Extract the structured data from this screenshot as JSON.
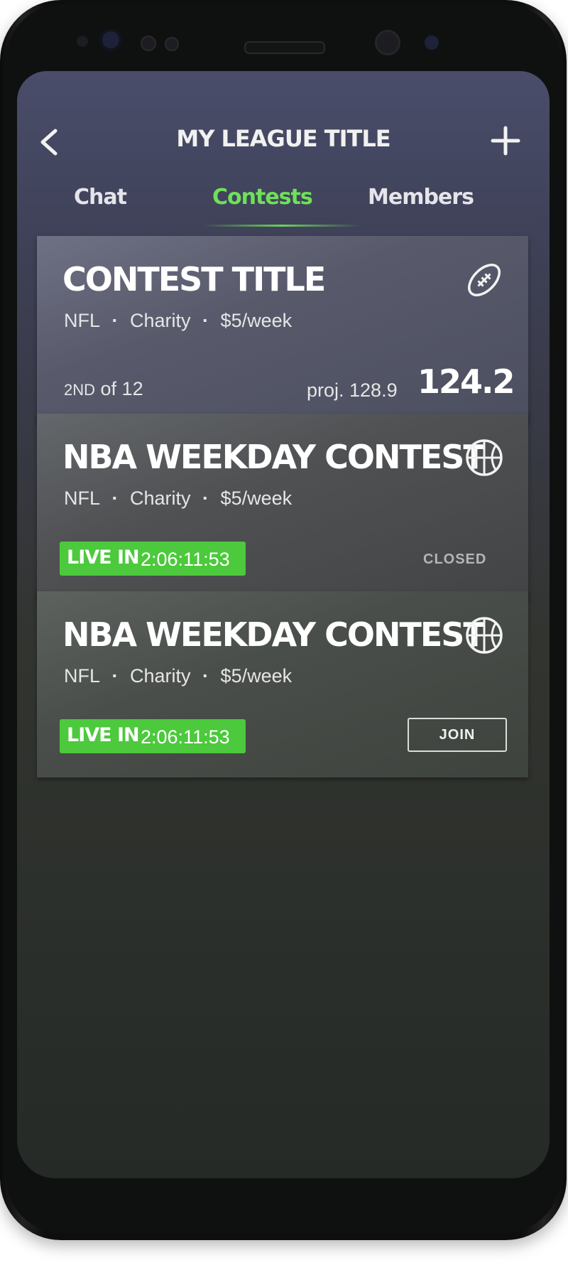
{
  "header": {
    "title": "MY LEAGUE TITLE",
    "back_icon": "chevron-left-icon",
    "add_icon": "plus-icon"
  },
  "tabs": [
    {
      "label": "Chat",
      "active": false
    },
    {
      "label": "Contests",
      "active": true
    },
    {
      "label": "Members",
      "active": false
    }
  ],
  "colors": {
    "accent": "#6fe05a",
    "live_badge": "#4cc93c"
  },
  "contests": [
    {
      "title": "CONTEST TITLE",
      "icon": "football-icon",
      "meta": {
        "sport": "NFL",
        "type": "Charity",
        "price": "$5/week"
      },
      "rank_ordinal": "2ND",
      "rank_of": "of 12",
      "projection": "proj. 128.9",
      "score": "124.2"
    },
    {
      "title": "NBA WEEKDAY CONTEST",
      "icon": "basketball-icon",
      "meta": {
        "sport": "NFL",
        "type": "Charity",
        "price": "$5/week"
      },
      "live_label": "LIVE IN",
      "countdown": "2:06:11:53",
      "status": "CLOSED"
    },
    {
      "title": "NBA WEEKDAY CONTEST",
      "icon": "basketball-icon",
      "meta": {
        "sport": "NFL",
        "type": "Charity",
        "price": "$5/week"
      },
      "live_label": "LIVE IN",
      "countdown": "2:06:11:53",
      "action": "JOIN"
    }
  ]
}
